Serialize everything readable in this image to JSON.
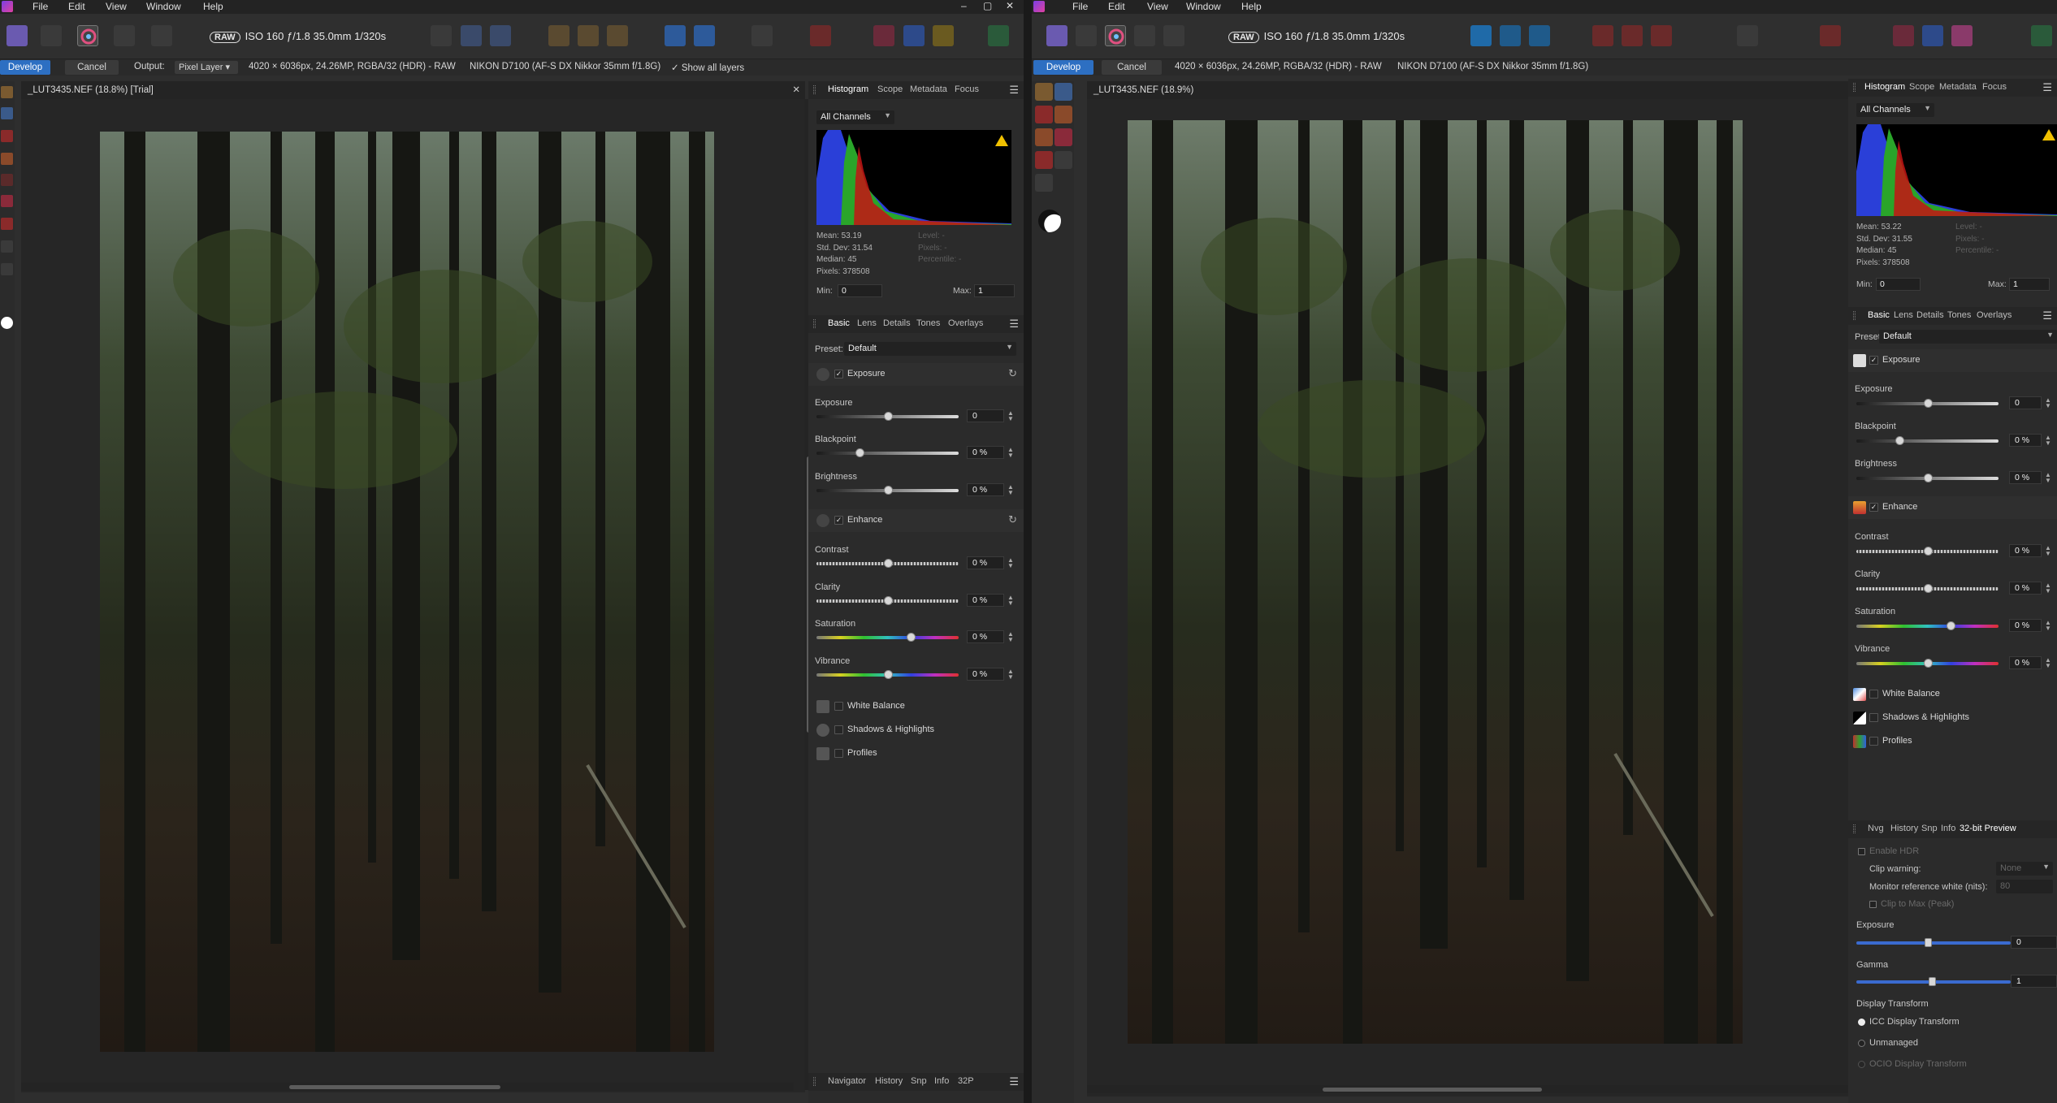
{
  "left": {
    "menu": [
      "File",
      "Edit",
      "View",
      "Window",
      "Help"
    ],
    "window_controls": [
      "–",
      "▢",
      "✕"
    ],
    "camera_info": "ISO 160 ƒ/1.8 35.0mm 1/320s",
    "raw_badge": "RAW",
    "context": {
      "develop": "Develop",
      "cancel": "Cancel",
      "output_label": "Output:",
      "output_value": "Pixel Layer",
      "file_info": "4020 × 6036px, 24.26MP, RGBA/32 (HDR) - RAW",
      "lens_info": "NIKON D7100 (AF-S DX Nikkor 35mm f/1.8G)",
      "show_layers": "Show all layers"
    },
    "doc_title": "_LUT3435.NEF (18.8%) [Trial]",
    "doc_close": "✕",
    "top_tabs": [
      "Histogram",
      "Scope",
      "Metadata",
      "Focus"
    ],
    "channels": "All Channels",
    "stats": [
      "Mean: 53.19",
      "Std. Dev: 31.54",
      "Median: 45",
      "Pixels: 378508"
    ],
    "stats_dim": [
      "Level: -",
      "Pixels: -",
      "Percentile: -"
    ],
    "min_label": "Min:",
    "min_value": "0",
    "max_label": "Max:",
    "max_value": "1",
    "basic_tabs": [
      "Basic",
      "Lens",
      "Details",
      "Tones",
      "Overlays"
    ],
    "preset_label": "Preset:",
    "preset_value": "Default",
    "exposure_section": "Exposure",
    "enhance_section": "Enhance",
    "sliders": [
      {
        "label": "Exposure",
        "value": "0",
        "pos": 0.5
      },
      {
        "label": "Blackpoint",
        "value": "0 %",
        "pos": 0.3
      },
      {
        "label": "Brightness",
        "value": "0 %",
        "pos": 0.5
      },
      {
        "label": "Contrast",
        "value": "0 %",
        "pos": 0.5
      },
      {
        "label": "Clarity",
        "value": "0 %",
        "pos": 0.5
      },
      {
        "label": "Saturation",
        "value": "0 %",
        "pos": 0.66
      },
      {
        "label": "Vibrance",
        "value": "0 %",
        "pos": 0.5
      }
    ],
    "extra_sections": [
      "White Balance",
      "Shadows & Highlights",
      "Profiles"
    ],
    "bottom_tabs": [
      "Navigator",
      "History",
      "Snp",
      "Info",
      "32P"
    ]
  },
  "right": {
    "menu": [
      "File",
      "Edit",
      "View",
      "Window",
      "Help"
    ],
    "window_controls": [
      "–",
      "▢",
      "✕"
    ],
    "camera_info": "ISO 160 ƒ/1.8 35.0mm 1/320s",
    "raw_badge": "RAW",
    "context": {
      "develop": "Develop",
      "cancel": "Cancel",
      "file_info": "4020 × 6036px, 24.26MP, RGBA/32 (HDR) - RAW",
      "lens_info": "NIKON D7100 (AF-S DX Nikkor 35mm f/1.8G)"
    },
    "doc_title": "_LUT3435.NEF (18.9%)",
    "doc_close": "✕",
    "top_tabs": [
      "Histogram",
      "Scope",
      "Metadata",
      "Focus"
    ],
    "channels": "All Channels",
    "stats": [
      "Mean: 53.22",
      "Std. Dev: 31.55",
      "Median: 45",
      "Pixels: 378508"
    ],
    "stats_dim": [
      "Level: -",
      "Pixels: -",
      "Percentile: -"
    ],
    "min_label": "Min:",
    "min_value": "0",
    "max_label": "Max:",
    "max_value": "1",
    "basic_tabs": [
      "Basic",
      "Lens",
      "Details",
      "Tones",
      "Overlays"
    ],
    "preset_label": "Preset:",
    "preset_value": "Default",
    "exposure_section": "Exposure",
    "enhance_section": "Enhance",
    "sliders": [
      {
        "label": "Exposure",
        "value": "0",
        "pos": 0.5
      },
      {
        "label": "Blackpoint",
        "value": "0 %",
        "pos": 0.3
      },
      {
        "label": "Brightness",
        "value": "0 %",
        "pos": 0.5
      },
      {
        "label": "Contrast",
        "value": "0 %",
        "pos": 0.5
      },
      {
        "label": "Clarity",
        "value": "0 %",
        "pos": 0.5
      },
      {
        "label": "Saturation",
        "value": "0 %",
        "pos": 0.66
      },
      {
        "label": "Vibrance",
        "value": "0 %",
        "pos": 0.5
      }
    ],
    "extra_sections": [
      "White Balance",
      "Shadows & Highlights",
      "Profiles"
    ],
    "bottom_tabs": [
      "Nvg",
      "History",
      "Snp",
      "Info",
      "32-bit Preview"
    ],
    "preview": {
      "enable_hdr": "Enable HDR",
      "clip_warning": "Clip warning:",
      "clip_value": "None",
      "monitor_ref": "Monitor reference white (nits):",
      "monitor_value": "80",
      "clip_to_max": "Clip to Max (Peak)",
      "exposure_label": "Exposure",
      "exposure_value": "0",
      "gamma_label": "Gamma",
      "gamma_value": "1",
      "display_transform": "Display Transform",
      "icc": "ICC Display Transform",
      "unmanaged": "Unmanaged",
      "ocio": "OCIO Display Transform"
    }
  },
  "colors": {
    "accent": "#2d6fc2",
    "panel": "#2b2b2b",
    "histo_blue": "#2a3fd8",
    "histo_green": "#2aa52a",
    "histo_red": "#c41414",
    "warn": "#f0c000"
  }
}
